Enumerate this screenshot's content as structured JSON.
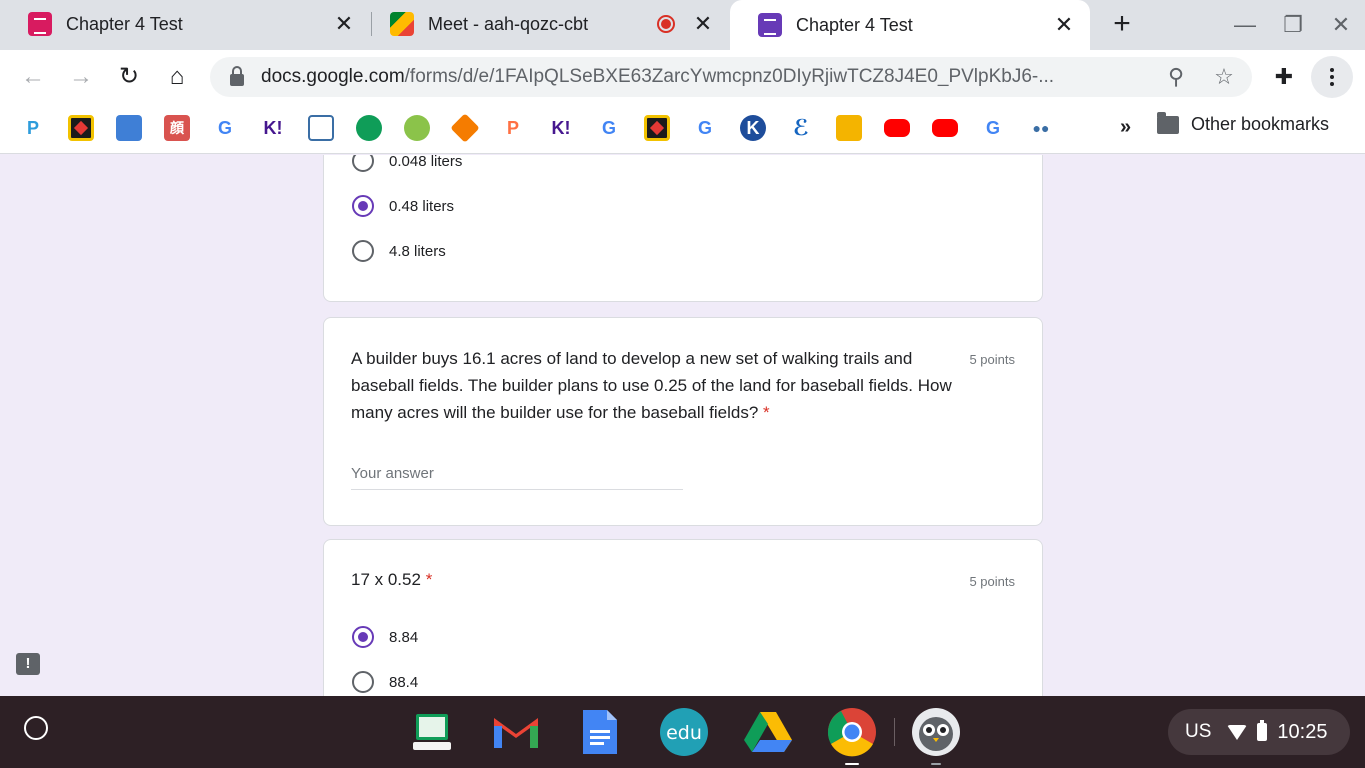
{
  "browser": {
    "tabs": [
      {
        "title": "Chapter 4 Test",
        "icon": "google-forms-icon",
        "color": "#d81b60",
        "active": false
      },
      {
        "title": "Meet - aah-qozc-cbt",
        "icon": "google-meet-icon",
        "recording": true,
        "active": false
      },
      {
        "title": "Chapter 4 Test",
        "icon": "google-forms-icon",
        "color": "#673ab7",
        "active": true
      }
    ],
    "close_glyph": "✕",
    "new_tab_glyph": "+",
    "address": {
      "host": "docs.google.com",
      "path": "/forms/d/e/1FAIpQLSeBXE63ZarcYwmcpnz0DIyRjiwTCZ8J4E0_PVlpKbJ6-..."
    },
    "bookmarks": {
      "overflow_glyph": "»",
      "other_label": "Other bookmarks"
    }
  },
  "form": {
    "prev_question": {
      "options": [
        {
          "label": "0.048 liters",
          "checked": false
        },
        {
          "label": "0.48 liters",
          "checked": true
        },
        {
          "label": "4.8 liters",
          "checked": false
        }
      ]
    },
    "question_land": {
      "text": "A builder buys 16.1 acres of land to develop a new set of walking trails and baseball fields. The builder plans to use 0.25 of the land for baseball fields. How many acres will the builder use for the baseball fields?",
      "required_mark": "*",
      "points": "5 points",
      "placeholder": "Your answer"
    },
    "question_multiply": {
      "text": "17 x 0.52",
      "required_mark": "*",
      "points": "5 points",
      "options": [
        {
          "label": "8.84",
          "checked": true
        },
        {
          "label": "88.4",
          "checked": false
        }
      ]
    },
    "feedback_glyph": "!"
  },
  "shelf": {
    "language": "US",
    "time": "10:25",
    "edu_label": "edu"
  },
  "colors": {
    "form_accent": "#673ab7",
    "form_background": "#f0ebf8",
    "required": "#d93025",
    "shelf": "#2d2025"
  }
}
